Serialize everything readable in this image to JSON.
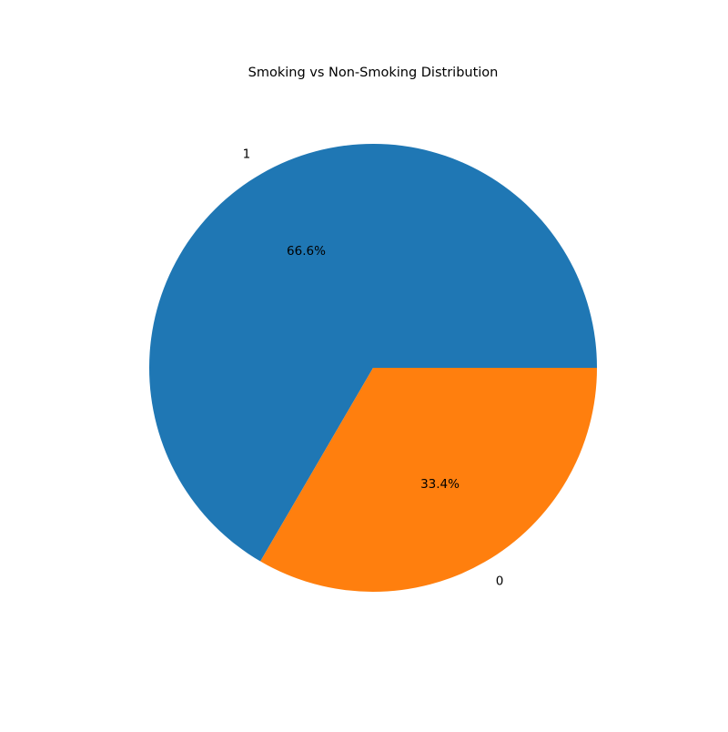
{
  "chart_data": {
    "type": "pie",
    "title": "Smoking vs Non-Smoking Distribution",
    "slices": [
      {
        "label": "1",
        "value": 66.6,
        "pct_label": "66.6%",
        "color": "#1f77b4"
      },
      {
        "label": "0",
        "value": 33.4,
        "pct_label": "33.4%",
        "color": "#ff7f0e"
      }
    ],
    "start_angle": 0,
    "direction": "counterclockwise",
    "legend": "none"
  }
}
